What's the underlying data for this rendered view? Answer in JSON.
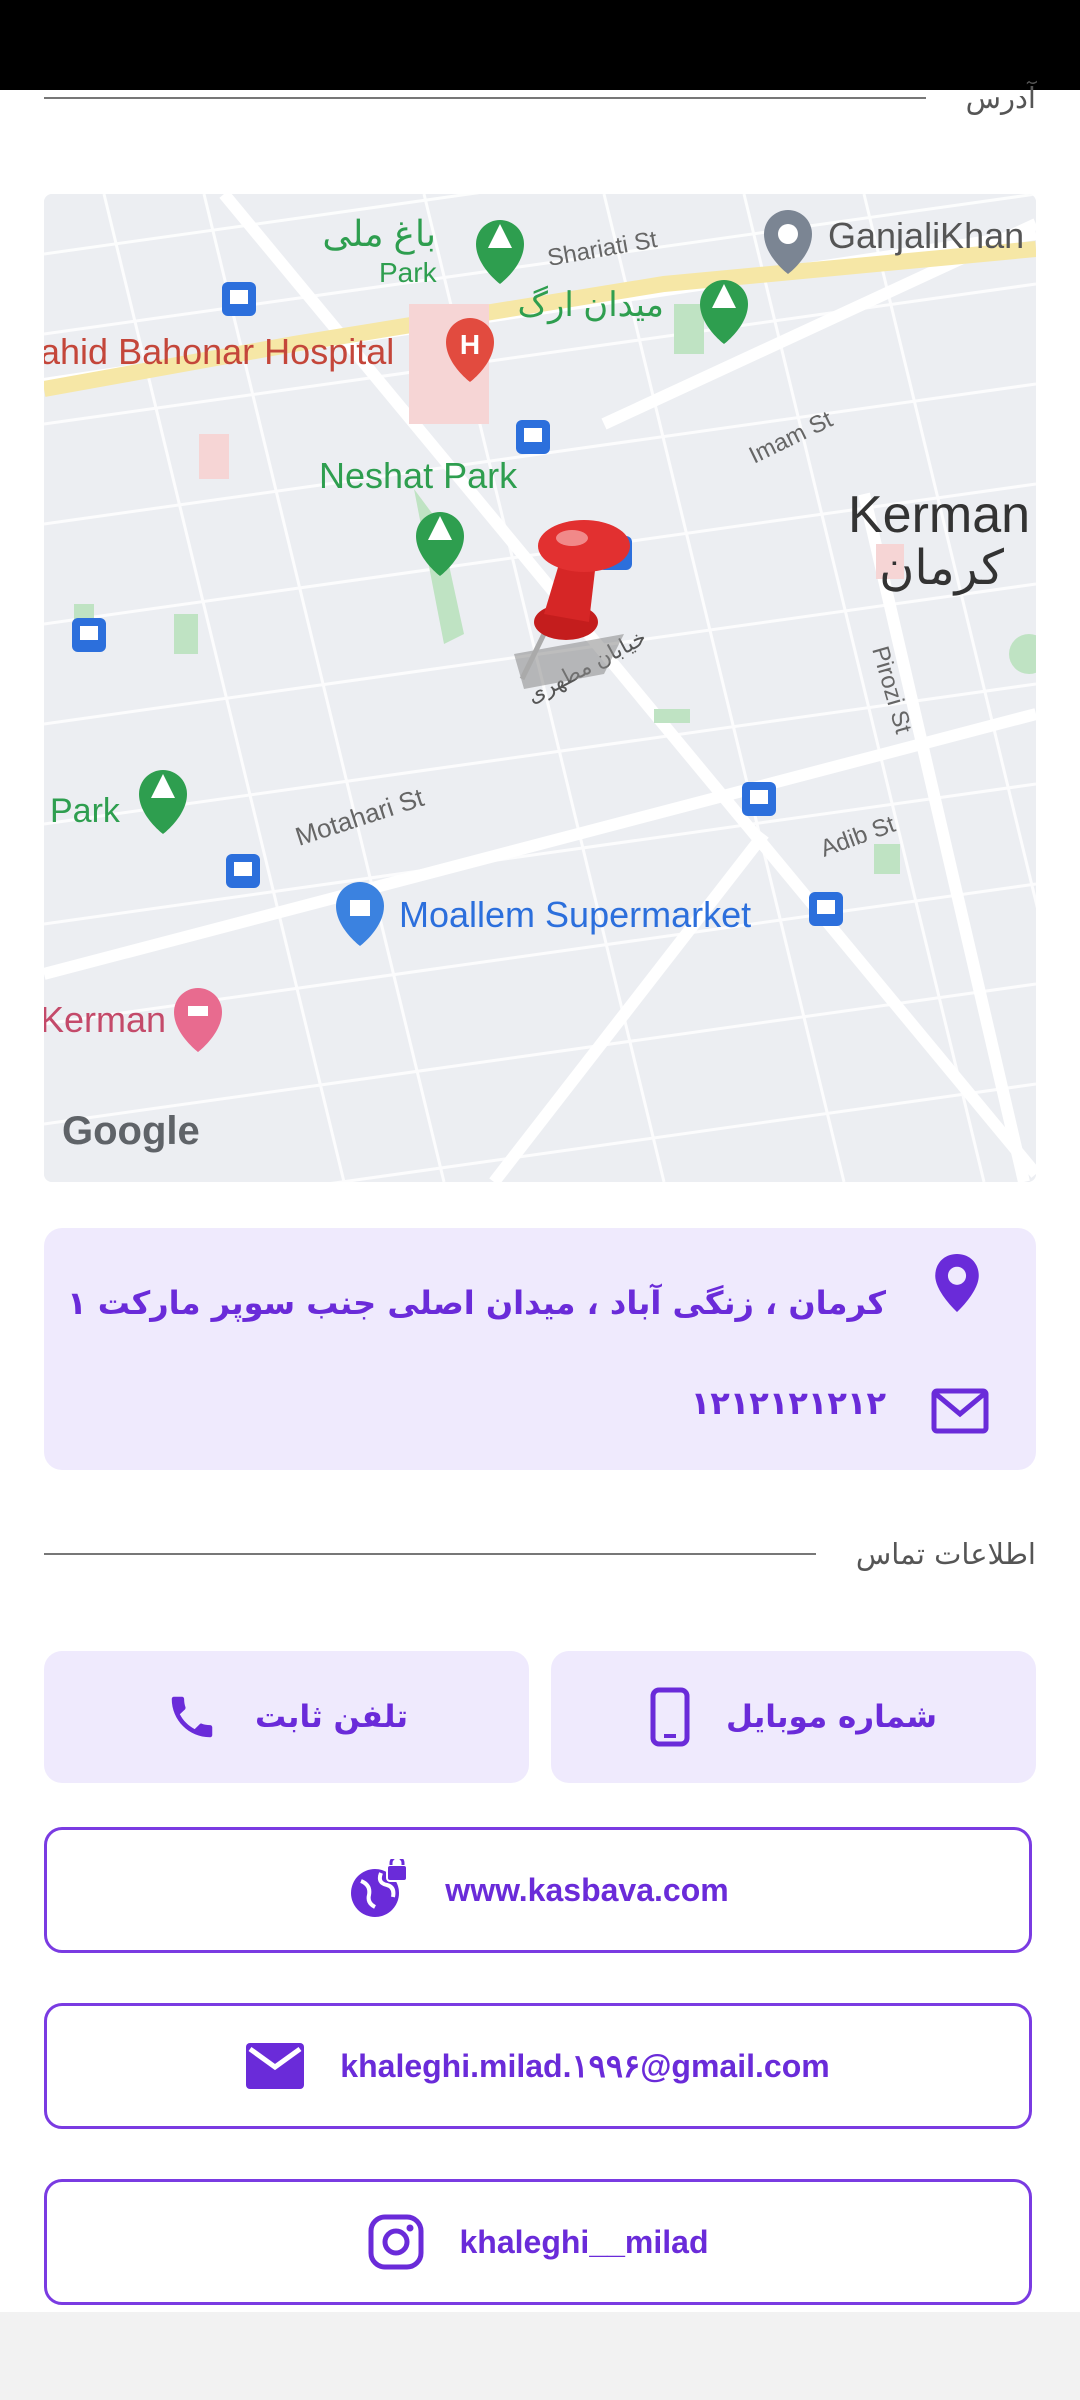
{
  "address_section": {
    "title": "آدرس"
  },
  "map": {
    "labels": {
      "bagh_melli": "باغ ملی",
      "park": "Park",
      "shariati": "Shariati St",
      "ganjalikhan": "GanjaliKhan",
      "meydan_arg": "میدان ارگ",
      "hospital": "ahid Bahonar Hospital",
      "imam": "Imam St",
      "neshat": "Neshat Park",
      "kerman_en": "Kerman",
      "kerman_fa": "کرمان",
      "motahari_fa": "خیابان مطهری",
      "pirozi": "Pirozi St",
      "park2": "Park",
      "motahari_en": "Motahari St",
      "adib": "Adib St",
      "supermarket": "Moallem Supermarket",
      "kerman_hotel": "Kerman",
      "google": "Google"
    }
  },
  "info": {
    "address": "کرمان ، زنگی آباد ، میدان اصلی جنب سوپر مارکت ۱",
    "postal": "۱۲۱۲۱۲۱۲۱۲"
  },
  "contact_section": {
    "title": "اطلاعات تماس"
  },
  "buttons": {
    "mobile": "شماره موبایل",
    "landline": "تلفن ثابت",
    "website": "www.kasbava.com",
    "email": "khaleghi.milad.۱۹۹۶@gmail.com",
    "instagram": "khaleghi__milad"
  },
  "colors": {
    "accent": "#6a2bd9",
    "soft_bg": "#efeafd",
    "outline": "#7a3be2"
  }
}
